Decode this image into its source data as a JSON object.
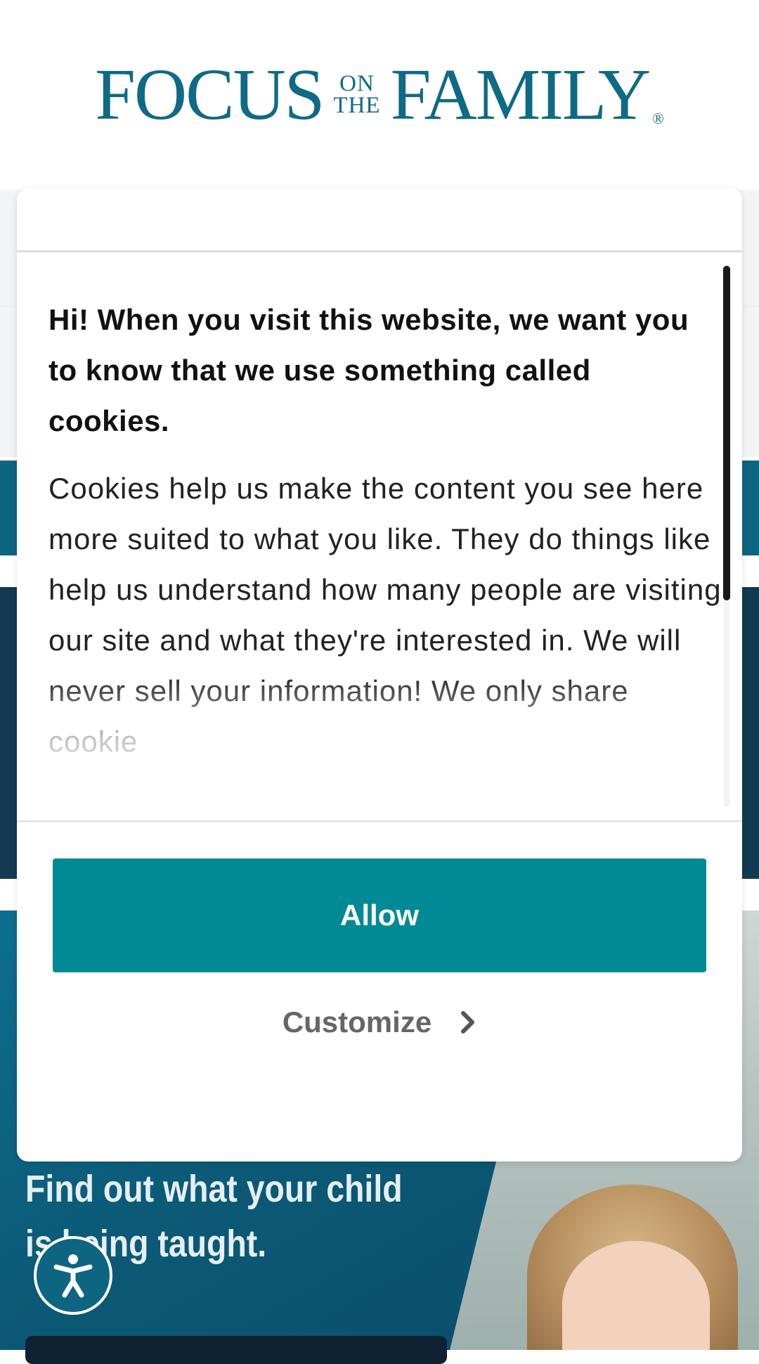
{
  "header": {
    "logo": {
      "focus": "FOCUS",
      "on": "ON",
      "the": "THE",
      "family": "FAMILY",
      "registered": "®",
      "color": "#0e6a86"
    }
  },
  "hero": {
    "line1": "Find out what your child",
    "line2": "is being taught."
  },
  "cookie_banner": {
    "heading": "Hi! When you visit this website, we want you to know that we use something called cookies.",
    "body": "Cookies help us make the content you see here more suited to what you like. They do things like help us understand how many people are visiting our site and what they're interested in. We will never sell your information! We only share cookie",
    "allow_label": "Allow",
    "customize_label": "Customize",
    "accent_color": "#008a96"
  },
  "accessibility": {
    "icon": "accessibility-icon"
  }
}
